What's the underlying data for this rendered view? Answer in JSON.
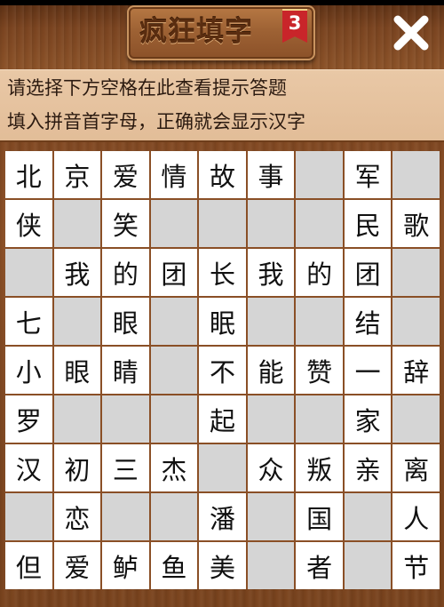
{
  "header": {
    "title": "疯狂填字",
    "level": "3",
    "close_icon": "close-icon"
  },
  "info": {
    "line1": "请选择下方空格在此查看提示答题",
    "line2": "填入拼音首字母，正确就会显示汉字"
  },
  "colors": {
    "wood": "#7a4420",
    "panel": "#e2bd98",
    "cell_filled": "#ffffff",
    "cell_empty": "#d5d5d5",
    "badge": "#c9252a"
  },
  "grid": [
    [
      "北",
      "京",
      "爱",
      "情",
      "故",
      "事",
      "",
      "军",
      ""
    ],
    [
      "侠",
      "",
      "笑",
      "",
      "",
      "",
      "",
      "民",
      "歌"
    ],
    [
      "",
      "我",
      "的",
      "团",
      "长",
      "我",
      "的",
      "团",
      ""
    ],
    [
      "七",
      "",
      "眼",
      "",
      "眠",
      "",
      "",
      "结",
      ""
    ],
    [
      "小",
      "眼",
      "睛",
      "",
      "不",
      "能",
      "赞",
      "一",
      "辞"
    ],
    [
      "罗",
      "",
      "",
      "",
      "起",
      "",
      "",
      "家",
      ""
    ],
    [
      "汉",
      "初",
      "三",
      "杰",
      "",
      "众",
      "叛",
      "亲",
      "离"
    ],
    [
      "",
      "恋",
      "",
      "",
      "潘",
      "",
      "国",
      "",
      "人"
    ],
    [
      "但",
      "爱",
      "鲈",
      "鱼",
      "美",
      "",
      "者",
      "",
      "节"
    ]
  ]
}
